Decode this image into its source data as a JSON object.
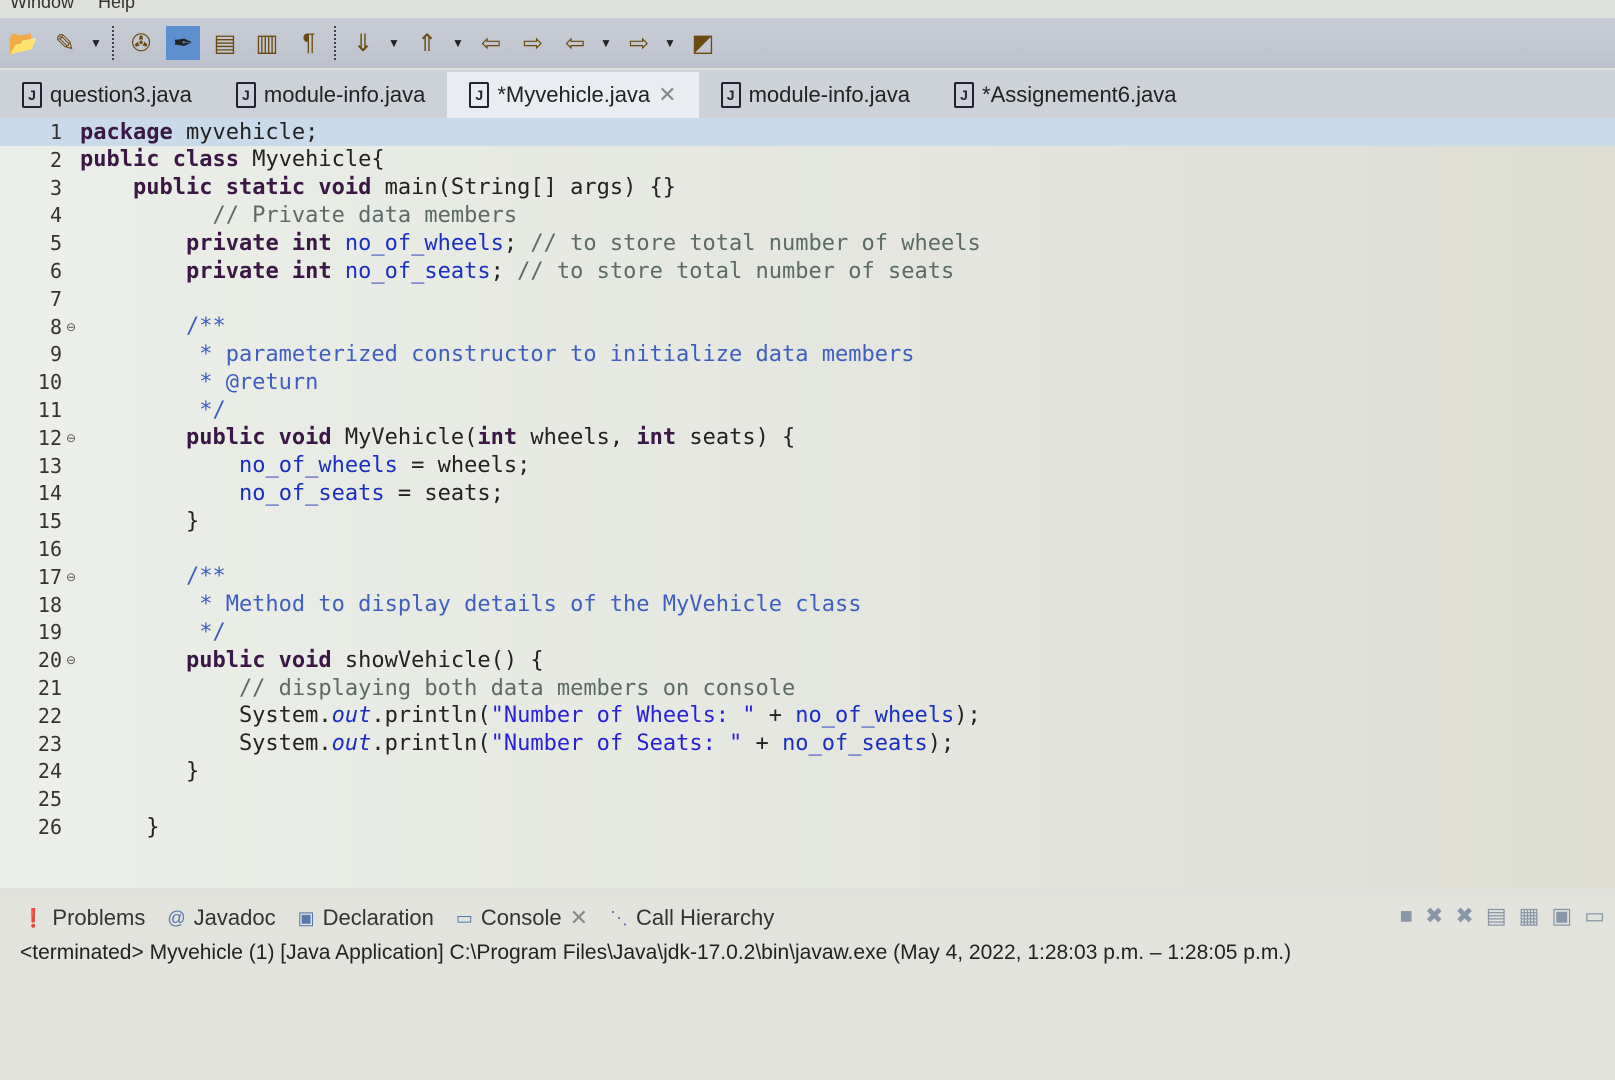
{
  "menu": [
    "Window",
    "Help"
  ],
  "toolbar": {
    "icons": [
      "open-icon",
      "build-icon",
      "dropdown",
      "debug-icon",
      "mark-occurrences-icon",
      "toggle-block-icon",
      "toggle-breadcrumb-icon",
      "show-whitespace-icon",
      "next-annotation-icon",
      "dropdown",
      "prev-annotation-icon",
      "dropdown",
      "last-edit-icon",
      "forward-edit-icon",
      "back-icon",
      "dropdown",
      "forward-icon",
      "dropdown",
      "new-window-icon"
    ]
  },
  "tabs": [
    {
      "label": "question3.java"
    },
    {
      "label": "module-info.java"
    },
    {
      "label": "*Myvehicle.java",
      "active": true
    },
    {
      "label": "module-info.java"
    },
    {
      "label": "*Assignement6.java"
    }
  ],
  "editor": {
    "lines": [
      [
        [
          "package",
          "k"
        ],
        [
          " myvehicle;",
          ""
        ]
      ],
      [
        [
          "public class",
          "k"
        ],
        [
          " Myvehicle{",
          ""
        ]
      ],
      [
        [
          "    ",
          ""
        ],
        [
          "public static void",
          "k"
        ],
        [
          " main(String[] args) {}",
          ""
        ]
      ],
      [
        [
          "          // Private data members",
          "c"
        ]
      ],
      [
        [
          "        ",
          ""
        ],
        [
          "private int",
          "k"
        ],
        [
          " ",
          ""
        ],
        [
          "no_of_wheels",
          "f"
        ],
        [
          "; ",
          ""
        ],
        [
          "// to store total number of wheels",
          "c"
        ]
      ],
      [
        [
          "        ",
          ""
        ],
        [
          "private int",
          "k"
        ],
        [
          " ",
          ""
        ],
        [
          "no_of_seats",
          "f"
        ],
        [
          "; ",
          ""
        ],
        [
          "// to store total number of seats",
          "c"
        ]
      ],
      [
        [
          "",
          ""
        ]
      ],
      [
        [
          "        /**",
          "j"
        ]
      ],
      [
        [
          "         * parameterized constructor to initialize data members",
          "j"
        ]
      ],
      [
        [
          "         * @return",
          "j"
        ]
      ],
      [
        [
          "         */",
          "j"
        ]
      ],
      [
        [
          "        ",
          ""
        ],
        [
          "public void",
          "k"
        ],
        [
          " MyVehicle(",
          ""
        ],
        [
          "int",
          "k"
        ],
        [
          " wheels, ",
          ""
        ],
        [
          "int",
          "k"
        ],
        [
          " seats) {",
          ""
        ]
      ],
      [
        [
          "            ",
          ""
        ],
        [
          "no_of_wheels",
          "f"
        ],
        [
          " = wheels;",
          ""
        ]
      ],
      [
        [
          "            ",
          ""
        ],
        [
          "no_of_seats",
          "f"
        ],
        [
          " = seats;",
          ""
        ]
      ],
      [
        [
          "        }",
          ""
        ]
      ],
      [
        [
          "",
          ""
        ]
      ],
      [
        [
          "        /**",
          "j"
        ]
      ],
      [
        [
          "         * Method to display details of the MyVehicle class",
          "j"
        ]
      ],
      [
        [
          "         */",
          "j"
        ]
      ],
      [
        [
          "        ",
          ""
        ],
        [
          "public void",
          "k"
        ],
        [
          " showVehicle() {",
          ""
        ]
      ],
      [
        [
          "            // displaying both data members on console",
          "c"
        ]
      ],
      [
        [
          "            System.",
          ""
        ],
        [
          "out",
          "i"
        ],
        [
          ".println(",
          ""
        ],
        [
          "\"Number of Wheels: \"",
          "s"
        ],
        [
          " + ",
          ""
        ],
        [
          "no_of_wheels",
          "f"
        ],
        [
          ");",
          ""
        ]
      ],
      [
        [
          "            System.",
          ""
        ],
        [
          "out",
          "i"
        ],
        [
          ".println(",
          ""
        ],
        [
          "\"Number of Seats: \"",
          "s"
        ],
        [
          " + ",
          ""
        ],
        [
          "no_of_seats",
          "f"
        ],
        [
          ");",
          ""
        ]
      ],
      [
        [
          "        }",
          ""
        ]
      ],
      [
        [
          "",
          ""
        ]
      ],
      [
        [
          "     }",
          ""
        ]
      ]
    ],
    "folds": [
      8,
      12,
      17,
      20
    ],
    "current_line": 1
  },
  "panel": {
    "tabs": [
      {
        "label": "Problems",
        "icon": "problems-icon"
      },
      {
        "label": "Javadoc",
        "icon": "javadoc-icon"
      },
      {
        "label": "Declaration",
        "icon": "declaration-icon"
      },
      {
        "label": "Console",
        "icon": "console-icon",
        "active": true
      },
      {
        "label": "Call Hierarchy",
        "icon": "call-hierarchy-icon"
      }
    ],
    "status": "<terminated> Myvehicle (1) [Java Application] C:\\Program Files\\Java\\jdk-17.0.2\\bin\\javaw.exe  (May 4, 2022, 1:28:03 p.m. – 1:28:05 p.m.)"
  }
}
